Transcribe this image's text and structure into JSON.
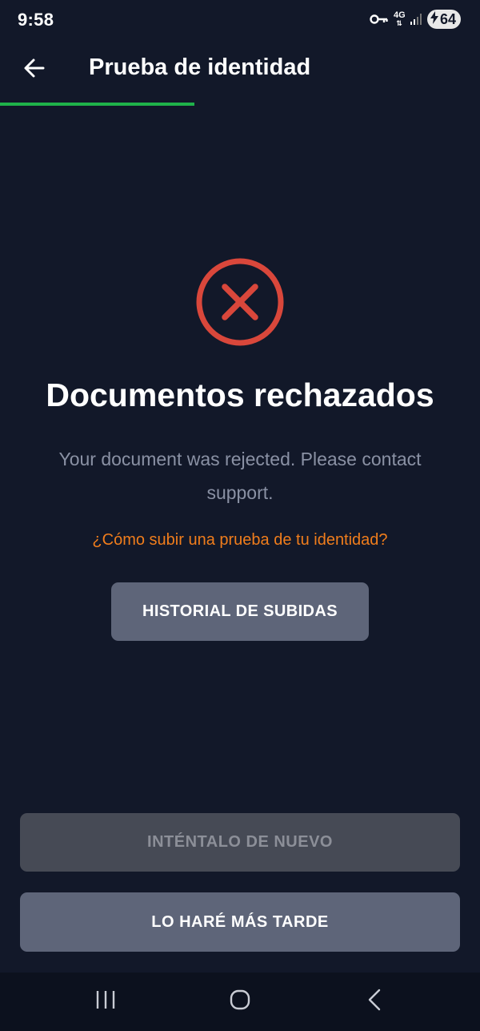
{
  "status_bar": {
    "time": "9:58",
    "network": "4G",
    "battery": "64",
    "icons": [
      "vpn-key-icon",
      "network-4g-icon",
      "signal-icon",
      "battery-charging-icon"
    ]
  },
  "header": {
    "back_icon": "arrow-left-icon",
    "title": "Prueba de identidad",
    "progress_fraction": 0.405,
    "progress_color": "#1fb24a"
  },
  "main": {
    "status_icon": "circle-x-icon",
    "status_color": "#d9473b",
    "title": "Documentos rechazados",
    "message": "Your document was rejected. Please contact support.",
    "help_link": "¿Cómo subir una prueba de tu identidad?",
    "help_link_color": "#f07d1c",
    "history_button": "HISTORIAL DE SUBIDAS"
  },
  "footer": {
    "retry_button": "INTÉNTALO DE NUEVO",
    "retry_disabled": true,
    "later_button": "LO HARÉ MÁS TARDE"
  },
  "nav_bar": {
    "icons": [
      "recent-apps-icon",
      "home-icon",
      "back-icon"
    ]
  },
  "colors": {
    "background": "#121829",
    "button": "#5e6579",
    "button_disabled": "#464a55"
  }
}
